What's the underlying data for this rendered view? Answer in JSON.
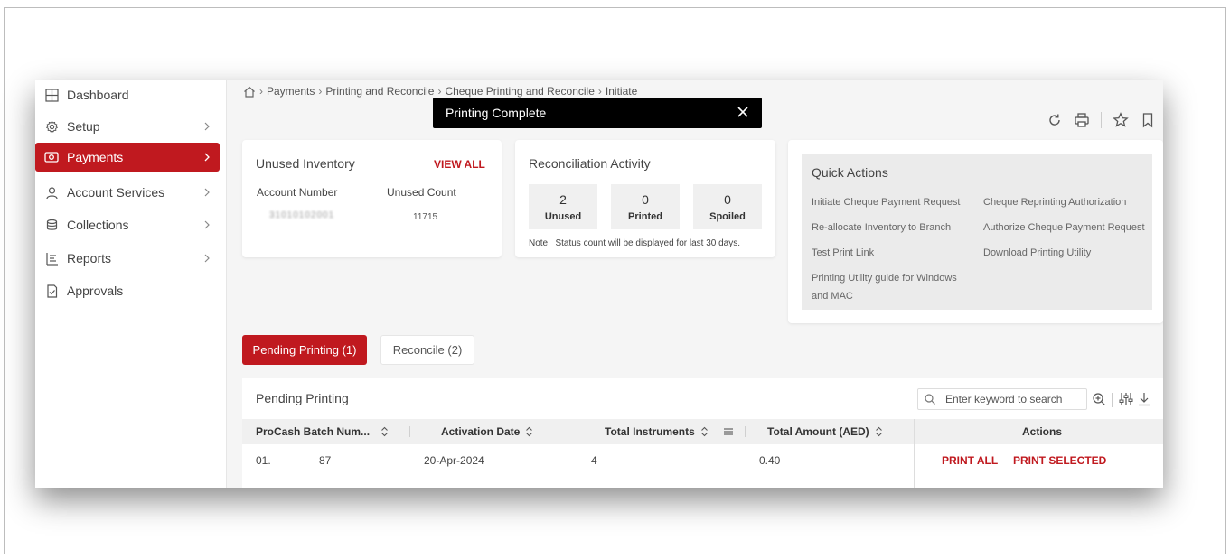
{
  "sidebar": {
    "items": [
      {
        "label": "Dashboard",
        "icon": "dashboard-icon",
        "has_chevron": false
      },
      {
        "label": "Setup",
        "icon": "gear-icon",
        "has_chevron": true
      },
      {
        "label": "Payments",
        "icon": "payments-icon",
        "has_chevron": true,
        "active": true
      },
      {
        "label": "Account Services",
        "icon": "user-icon",
        "has_chevron": true
      },
      {
        "label": "Collections",
        "icon": "collections-icon",
        "has_chevron": true
      },
      {
        "label": "Reports",
        "icon": "reports-icon",
        "has_chevron": true
      },
      {
        "label": "Approvals",
        "icon": "approvals-icon",
        "has_chevron": false
      }
    ]
  },
  "breadcrumb": {
    "home_icon": "home-icon",
    "items": [
      "Payments",
      "Printing and Reconcile",
      "Cheque Printing and Reconcile",
      "Initiate"
    ]
  },
  "toast": {
    "message": "Printing Complete"
  },
  "toolbar": {
    "icons": [
      "refresh-icon",
      "print-icon",
      "star-icon",
      "bookmark-icon"
    ]
  },
  "inventory": {
    "title": "Unused Inventory",
    "view_all": "VIEW ALL",
    "col_account": "Account Number",
    "col_count": "Unused Count",
    "account_value": "31010102001",
    "count_value": "11715"
  },
  "reconciliation": {
    "title": "Reconciliation Activity",
    "stats": [
      {
        "value": "2",
        "label": "Unused"
      },
      {
        "value": "0",
        "label": "Printed"
      },
      {
        "value": "0",
        "label": "Spoiled"
      }
    ],
    "note": "Note:  Status count will be displayed for last 30 days."
  },
  "quick_actions": {
    "title": "Quick Actions",
    "left_links": [
      "Initiate Cheque Payment Request",
      "Re-allocate Inventory to Branch",
      "Test Print Link",
      "Printing Utility guide for Windows and MAC"
    ],
    "right_links": [
      "Cheque Reprinting Authorization",
      "Authorize Cheque Payment Request",
      "Download Printing Utility"
    ]
  },
  "tabs": [
    {
      "label": "Pending Printing",
      "count": "(1)",
      "active": true
    },
    {
      "label": "Reconcile",
      "count": "(2)",
      "active": false
    }
  ],
  "table": {
    "title": "Pending Printing",
    "search_placeholder": "Enter keyword to search",
    "columns": [
      "ProCash Batch Num...",
      "Activation Date",
      "Total Instruments",
      "Total Amount (AED)",
      "Actions"
    ],
    "rows": [
      {
        "batch_prefix": "01.",
        "batch_suffix": "87",
        "date": "20-Apr-2024",
        "instruments": "4",
        "amount": "0.40",
        "action_all": "PRINT ALL",
        "action_selected": "PRINT SELECTED"
      }
    ]
  },
  "colors": {
    "accent": "#c0191f",
    "toast_bg": "#000000"
  }
}
